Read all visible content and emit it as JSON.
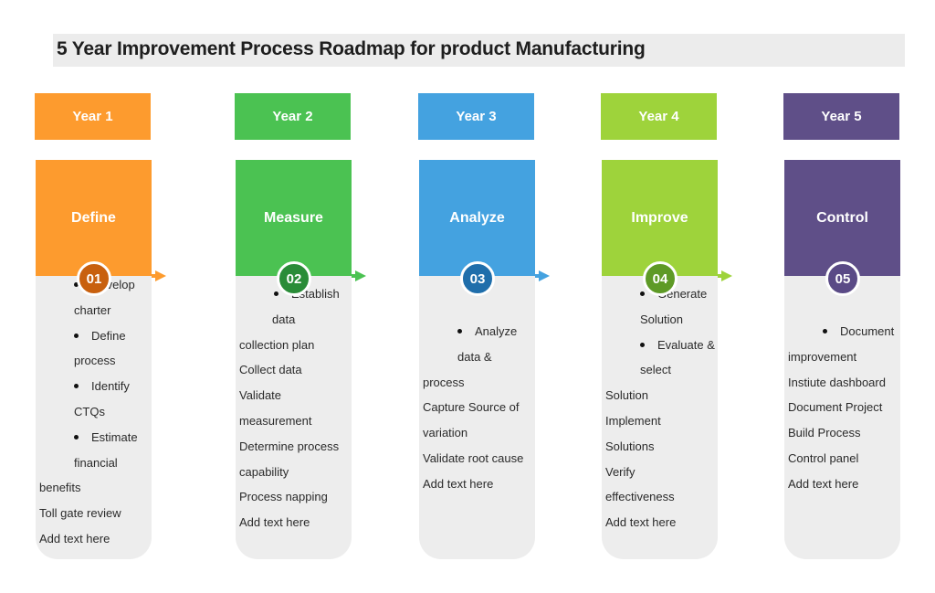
{
  "title": "5 Year Improvement Process Roadmap for product Manufacturing",
  "columns": [
    {
      "year": "Year 1",
      "phase": "Define",
      "number": "01",
      "color": "#fd9b2e",
      "badge_color": "#c8600e",
      "lines": [
        {
          "text": "Develop",
          "bullet": true,
          "indent": 1
        },
        {
          "text": "charter",
          "indent": 1
        },
        {
          "text": "Define",
          "bullet": true,
          "indent": 1
        },
        {
          "text": "process",
          "indent": 1
        },
        {
          "text": "Identify",
          "bullet": true,
          "indent": 1
        },
        {
          "text": "CTQs",
          "indent": 1
        },
        {
          "text": "Estimate",
          "bullet": true,
          "indent": 1
        },
        {
          "text": "financial",
          "indent": 1
        },
        {
          "text": "benefits",
          "indent": 0
        },
        {
          "text": "Toll gate review",
          "indent": 0
        },
        {
          "text": "Add text here",
          "indent": 0
        }
      ]
    },
    {
      "year": "Year 2",
      "phase": "Measure",
      "number": "02",
      "color": "#4bc252",
      "badge_color": "#2a8c38",
      "lines": [
        {
          "text": "Establish",
          "bullet": true,
          "indent": 1
        },
        {
          "text": "data",
          "indent": 1
        },
        {
          "text": "collection plan",
          "indent": 0
        },
        {
          "text": "Collect data",
          "indent": 0
        },
        {
          "text": "Validate",
          "indent": 0
        },
        {
          "text": "measurement",
          "indent": 0
        },
        {
          "text": "Determine process",
          "indent": 0
        },
        {
          "text": "capability",
          "indent": 0
        },
        {
          "text": "Process napping",
          "indent": 0
        },
        {
          "text": "Add text here",
          "indent": 0
        }
      ]
    },
    {
      "year": "Year 3",
      "phase": "Analyze",
      "number": "03",
      "color": "#44a2e0",
      "badge_color": "#1f6eab",
      "lines": [
        {
          "text": "Analyze",
          "bullet": true,
          "indent": 1
        },
        {
          "text": "data &",
          "indent": 1
        },
        {
          "text": "process",
          "indent": 0
        },
        {
          "text": "Capture Source of",
          "indent": 0
        },
        {
          "text": "variation",
          "indent": 0
        },
        {
          "text": "Validate root cause",
          "indent": 0
        },
        {
          "text": "Add text here",
          "indent": 0
        }
      ]
    },
    {
      "year": "Year 4",
      "phase": "Improve",
      "number": "04",
      "color": "#9ed33b",
      "badge_color": "#5e9a26",
      "lines": [
        {
          "text": "Generate",
          "bullet": true,
          "indent": 1
        },
        {
          "text": "Solution",
          "indent": 1
        },
        {
          "text": "Evaluate &",
          "bullet": true,
          "indent": 1
        },
        {
          "text": "select",
          "indent": 1
        },
        {
          "text": "Solution",
          "indent": 0
        },
        {
          "text": "Implement",
          "indent": 0
        },
        {
          "text": "Solutions",
          "indent": 0
        },
        {
          "text": "Verify",
          "indent": 0
        },
        {
          "text": "effectiveness",
          "indent": 0
        },
        {
          "text": "Add text here",
          "indent": 0
        }
      ]
    },
    {
      "year": "Year 5",
      "phase": "Control",
      "number": "05",
      "color": "#5f4f88",
      "badge_color": "#5a4a86",
      "lines": [
        {
          "text": "Document",
          "bullet": true,
          "indent": 1
        },
        {
          "text": "improvement",
          "indent": 0
        },
        {
          "text": "Instiute dashboard",
          "indent": 0
        },
        {
          "text": "Document Project",
          "indent": 0
        },
        {
          "text": "Build Process",
          "indent": 0
        },
        {
          "text": "Control panel",
          "indent": 0
        },
        {
          "text": "Add text here",
          "indent": 0
        }
      ]
    }
  ]
}
